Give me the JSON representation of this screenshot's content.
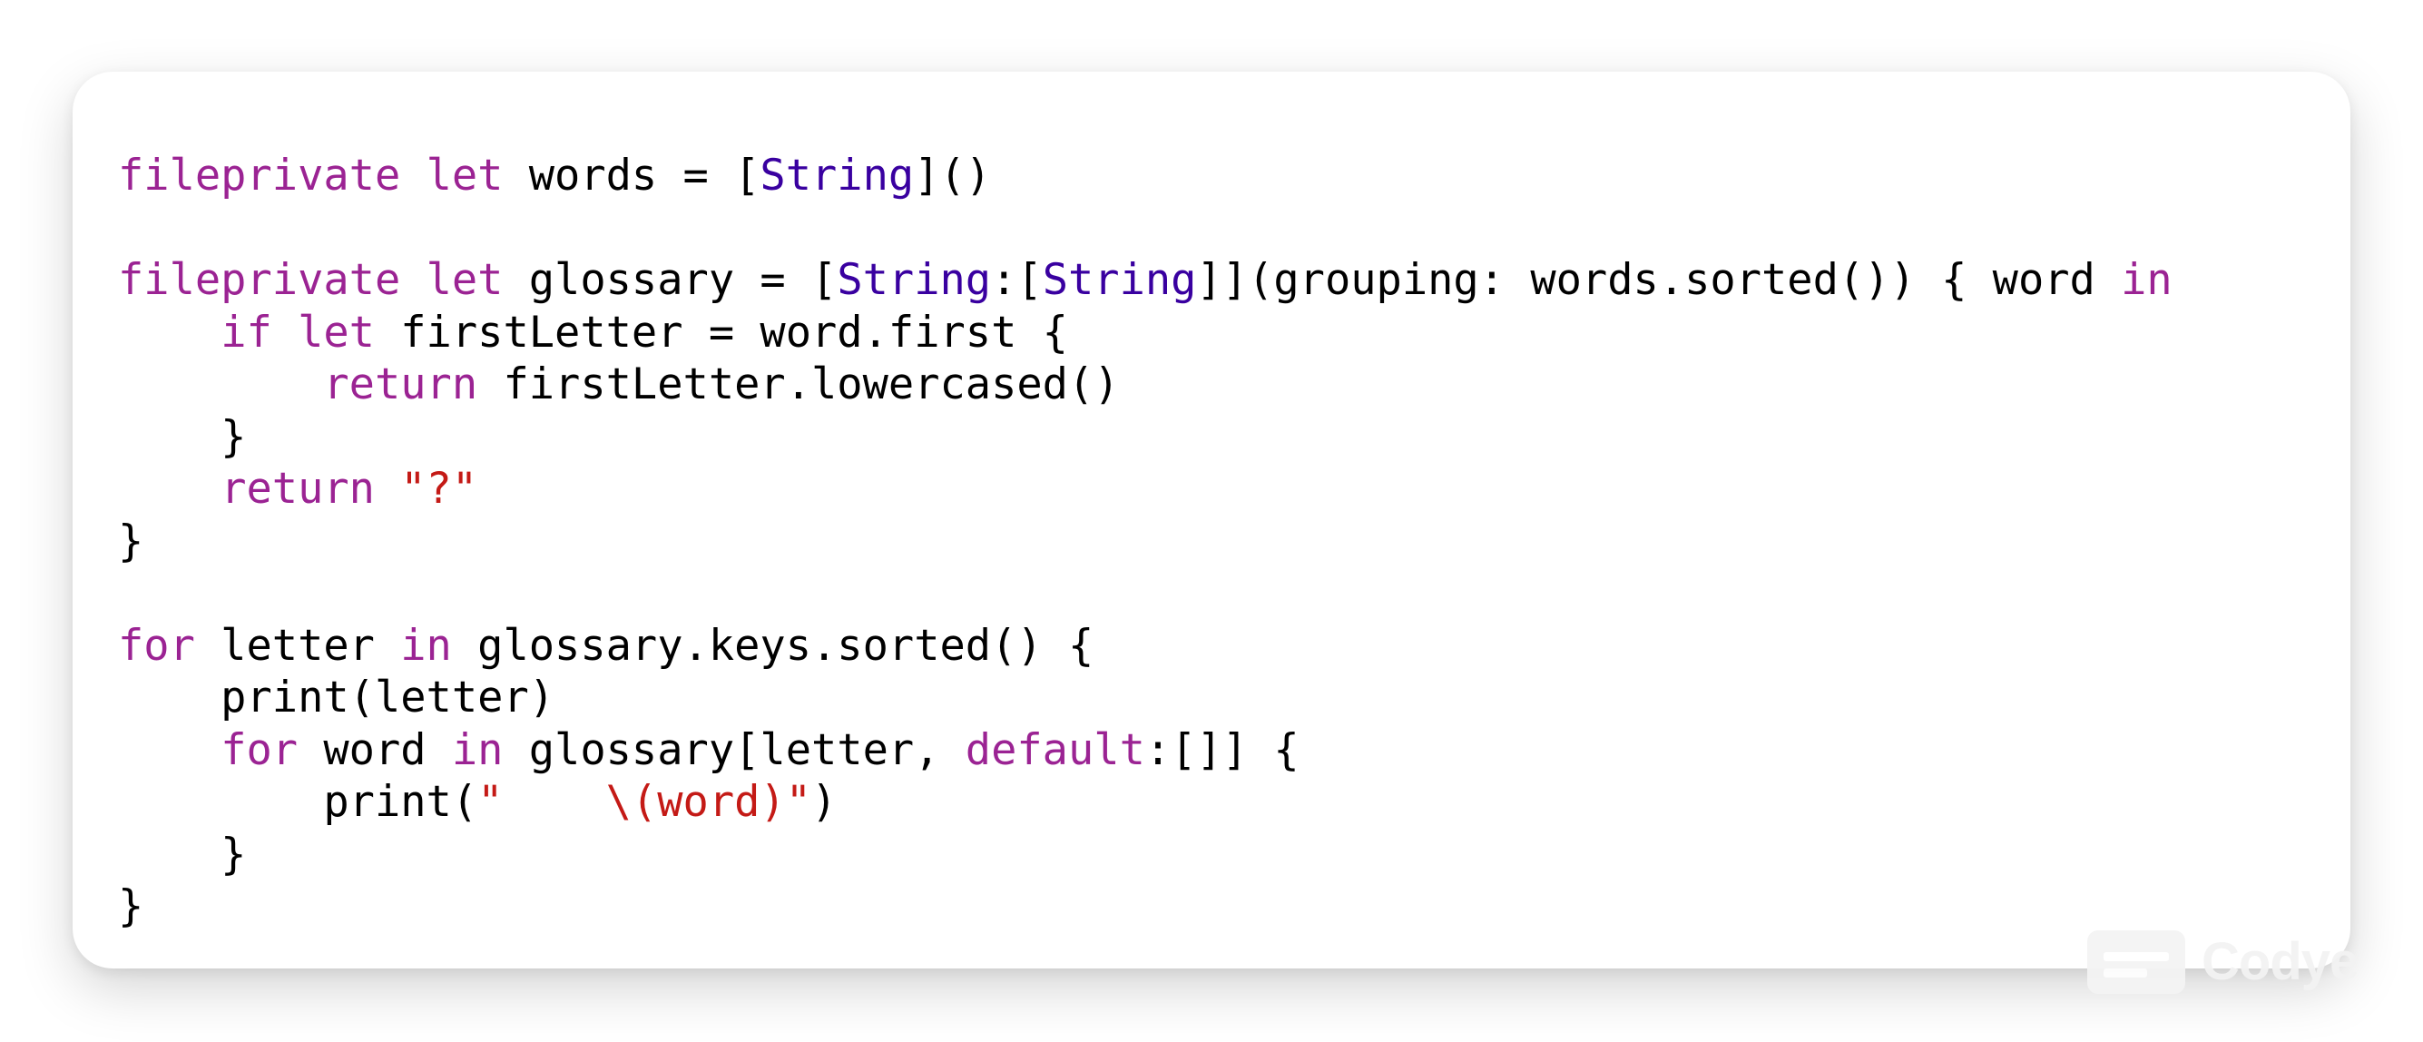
{
  "colors": {
    "keyword": "#9b2393",
    "type": "#3900a0",
    "string": "#c41a16",
    "plain": "#000000",
    "card_background": "#ffffff"
  },
  "code": {
    "lines": [
      [
        {
          "text": "fileprivate",
          "kind": "keyword"
        },
        {
          "text": " ",
          "kind": "plain"
        },
        {
          "text": "let",
          "kind": "keyword"
        },
        {
          "text": " words = [",
          "kind": "plain"
        },
        {
          "text": "String",
          "kind": "type"
        },
        {
          "text": "]()",
          "kind": "plain"
        }
      ],
      [],
      [
        {
          "text": "fileprivate",
          "kind": "keyword"
        },
        {
          "text": " ",
          "kind": "plain"
        },
        {
          "text": "let",
          "kind": "keyword"
        },
        {
          "text": " glossary = [",
          "kind": "plain"
        },
        {
          "text": "String",
          "kind": "type"
        },
        {
          "text": ":[",
          "kind": "plain"
        },
        {
          "text": "String",
          "kind": "type"
        },
        {
          "text": "]](grouping: words.sorted()) { word ",
          "kind": "plain"
        },
        {
          "text": "in",
          "kind": "keyword"
        }
      ],
      [
        {
          "text": "    ",
          "kind": "plain"
        },
        {
          "text": "if",
          "kind": "keyword"
        },
        {
          "text": " ",
          "kind": "plain"
        },
        {
          "text": "let",
          "kind": "keyword"
        },
        {
          "text": " firstLetter = word.first {",
          "kind": "plain"
        }
      ],
      [
        {
          "text": "        ",
          "kind": "plain"
        },
        {
          "text": "return",
          "kind": "keyword"
        },
        {
          "text": " firstLetter.lowercased()",
          "kind": "plain"
        }
      ],
      [
        {
          "text": "    }",
          "kind": "plain"
        }
      ],
      [
        {
          "text": "    ",
          "kind": "plain"
        },
        {
          "text": "return",
          "kind": "keyword"
        },
        {
          "text": " ",
          "kind": "plain"
        },
        {
          "text": "\"?\"",
          "kind": "string"
        }
      ],
      [
        {
          "text": "}",
          "kind": "plain"
        }
      ],
      [],
      [
        {
          "text": "for",
          "kind": "keyword"
        },
        {
          "text": " letter ",
          "kind": "plain"
        },
        {
          "text": "in",
          "kind": "keyword"
        },
        {
          "text": " glossary.keys.sorted() {",
          "kind": "plain"
        }
      ],
      [
        {
          "text": "    print(letter)",
          "kind": "plain"
        }
      ],
      [
        {
          "text": "    ",
          "kind": "plain"
        },
        {
          "text": "for",
          "kind": "keyword"
        },
        {
          "text": " word ",
          "kind": "plain"
        },
        {
          "text": "in",
          "kind": "keyword"
        },
        {
          "text": " glossary[letter, ",
          "kind": "plain"
        },
        {
          "text": "default",
          "kind": "keyword"
        },
        {
          "text": ":[]] {",
          "kind": "plain"
        }
      ],
      [
        {
          "text": "        print(",
          "kind": "plain"
        },
        {
          "text": "\"    \\(word)\"",
          "kind": "string"
        },
        {
          "text": ")",
          "kind": "plain"
        }
      ],
      [
        {
          "text": "    }",
          "kind": "plain"
        }
      ],
      [
        {
          "text": "}",
          "kind": "plain"
        }
      ]
    ]
  },
  "watermark": {
    "icon": "code-snippet-icon",
    "label": "Codye"
  }
}
